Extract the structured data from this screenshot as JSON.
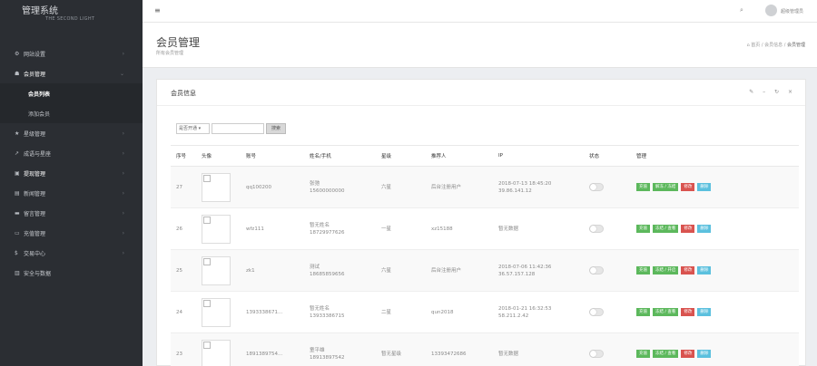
{
  "brand": {
    "title": "管理系统",
    "subtitle": "THE SECOND LIGHT"
  },
  "sidebar": {
    "items": [
      {
        "icon": "gears-icon",
        "glyph": "⚙",
        "label": "网站设置"
      },
      {
        "icon": "users-icon",
        "glyph": "☗",
        "label": "会员管理",
        "active": true
      },
      {
        "icon": "star-icon",
        "glyph": "★",
        "label": "星级管理"
      },
      {
        "icon": "chart-icon",
        "glyph": "↗",
        "label": "成语与星座"
      },
      {
        "icon": "money-icon",
        "glyph": "▣",
        "label": "提现管理"
      },
      {
        "icon": "news-icon",
        "glyph": "▤",
        "label": "新闻管理"
      },
      {
        "icon": "comment-icon",
        "glyph": "▬",
        "label": "留言管理"
      },
      {
        "icon": "card-icon",
        "glyph": "▭",
        "label": "充值管理"
      },
      {
        "icon": "dollar-icon",
        "glyph": "$",
        "label": "交易中心"
      },
      {
        "icon": "building-icon",
        "glyph": "▥",
        "label": "安全与数据"
      }
    ],
    "subitems": [
      {
        "label": "会员列表",
        "active": true
      },
      {
        "label": "添加会员"
      }
    ]
  },
  "topbar": {
    "menu_glyph": "≡",
    "search_glyph": "⌕",
    "username": "超级管理员"
  },
  "page": {
    "title": "会员管理",
    "subtitle": "所有会员管理"
  },
  "breadcrumb": {
    "home": "⌂ 首页",
    "sep": "/",
    "mid": "会员信息",
    "current": "会员管理"
  },
  "panel": {
    "title": "会员信息",
    "tools": "✎ – ↻ ×"
  },
  "filter": {
    "select_value": "是否开通 ▾",
    "search_button": "搜索"
  },
  "table": {
    "headers": [
      "序号",
      "头像",
      "账号",
      "姓名/手机",
      "星级",
      "推荐人",
      "IP",
      "状态",
      "管理"
    ],
    "rows": [
      {
        "no": "27",
        "account": "qq100200",
        "name": "张弛",
        "phone": "15600000000",
        "level": "六星",
        "referrer": "后台注册用户",
        "referrer_red": false,
        "ip_time": "2018-07-13 18:45:20",
        "ip": "39.86.141.12",
        "ip_color": "org",
        "b2": "解冻 / 冻结"
      },
      {
        "no": "26",
        "account": "wfz111",
        "name": "暂无姓名",
        "phone": "18729977626",
        "level": "一星",
        "referrer": "xz15188",
        "referrer_red": true,
        "ip_time": "暂无数据",
        "ip": "",
        "ip_color": "",
        "b2": "冻结 / 查看"
      },
      {
        "no": "25",
        "account": "zk1",
        "name": "测试",
        "phone": "18685859656",
        "level": "六星",
        "referrer": "后台注册用户",
        "referrer_red": false,
        "ip_time": "2018-07-06 11:42:36",
        "ip": "36.57.157.128",
        "ip_color": "org",
        "b2": "冻结 / 开启"
      },
      {
        "no": "24",
        "account": "1393338671...",
        "name": "暂无姓名",
        "phone": "13933386715",
        "level": "二星",
        "referrer": "qun2018",
        "referrer_red": true,
        "ip_time": "2018-01-21 16:32:53",
        "ip": "58.211.2.42",
        "ip_color": "org",
        "b2": "冻结 / 查看"
      },
      {
        "no": "23",
        "account": "1891389754...",
        "name": "童平雄",
        "phone": "18913897542",
        "level": "暂无星级",
        "referrer": "13393472686",
        "referrer_red": true,
        "ip_time": "暂无数据",
        "ip": "",
        "ip_color": "",
        "b2": "冻结 / 查看"
      }
    ],
    "actions": {
      "b1": "充值",
      "b3": "修改",
      "b4": "删除"
    }
  }
}
